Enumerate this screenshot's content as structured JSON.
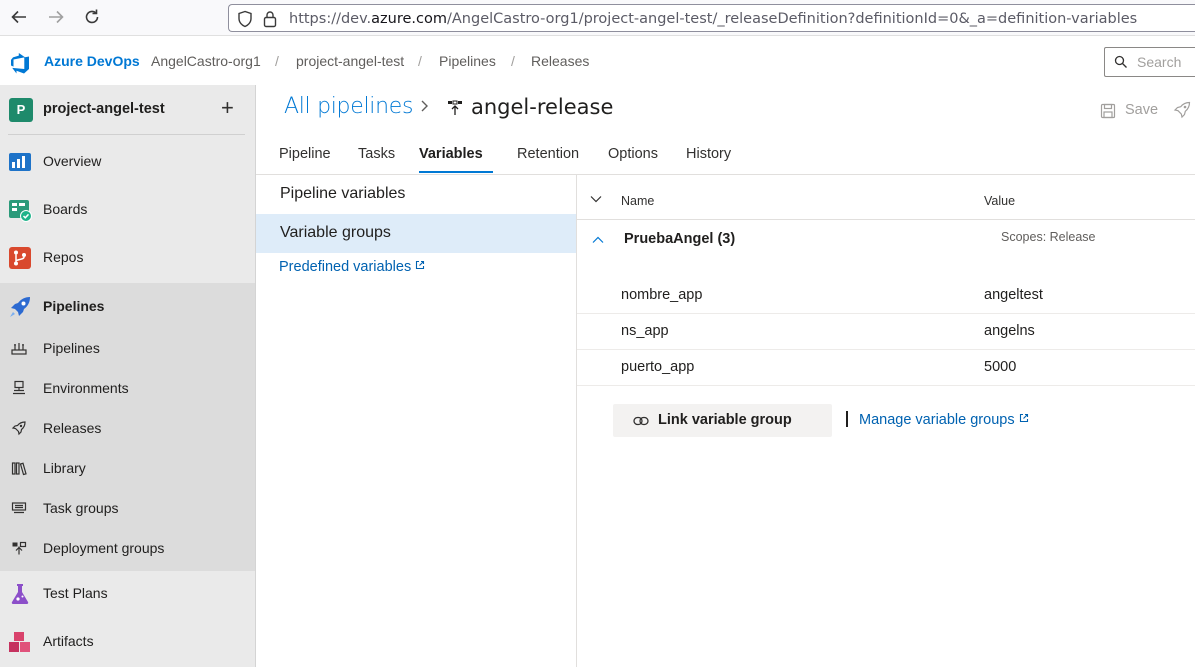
{
  "browser": {
    "url_prefix": "https://dev.",
    "url_domain": "azure.com",
    "url_rest": "/AngelCastro-org1/project-angel-test/_releaseDefinition?definitionId=0&_a=definition-variables"
  },
  "header": {
    "brand": "Azure DevOps",
    "breadcrumbs": [
      "AngelCastro-org1",
      "project-angel-test",
      "Pipelines",
      "Releases"
    ],
    "search_placeholder": "Search"
  },
  "sidebar": {
    "project_initial": "P",
    "project_name": "project-angel-test",
    "add_label": "+",
    "items": [
      {
        "label": "Overview"
      },
      {
        "label": "Boards"
      },
      {
        "label": "Repos"
      },
      {
        "label": "Pipelines"
      },
      {
        "label": "Test Plans"
      },
      {
        "label": "Artifacts"
      }
    ],
    "pipelines_sub": [
      {
        "label": "Pipelines"
      },
      {
        "label": "Environments"
      },
      {
        "label": "Releases"
      },
      {
        "label": "Library"
      },
      {
        "label": "Task groups"
      },
      {
        "label": "Deployment groups"
      }
    ]
  },
  "page": {
    "all_pipelines": "All pipelines",
    "title": "angel-release",
    "save_label": "Save",
    "tabs": [
      "Pipeline",
      "Tasks",
      "Variables",
      "Retention",
      "Options",
      "History"
    ],
    "active_tab": "Variables"
  },
  "leftpane": {
    "pipeline_variables": "Pipeline variables",
    "variable_groups": "Variable groups",
    "predefined_variables": "Predefined variables"
  },
  "grid": {
    "col_name": "Name",
    "col_value": "Value",
    "group_name": "PruebaAngel (3)",
    "group_scope": "Scopes: Release",
    "rows": [
      {
        "name": "nombre_app",
        "value": "angeltest"
      },
      {
        "name": "ns_app",
        "value": "angelns"
      },
      {
        "name": "puerto_app",
        "value": "5000"
      }
    ],
    "link_button": "Link variable group",
    "manage_link": "Manage variable groups"
  }
}
